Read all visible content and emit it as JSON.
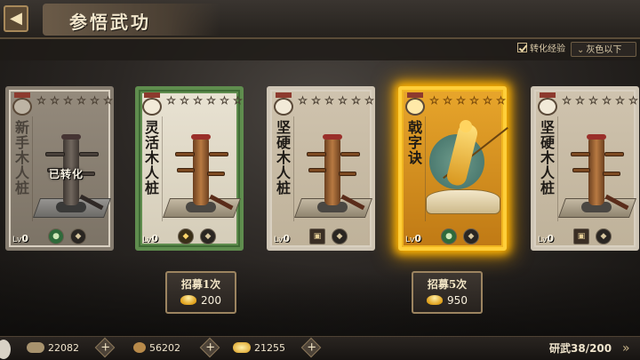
{
  "header": {
    "back_icon": "back-arrow-icon",
    "title": "参悟武功"
  },
  "filters": {
    "convert_exp_label": "转化经验",
    "convert_exp_checked": true,
    "quality_select": "灰色以下"
  },
  "cards": [
    {
      "name": "新手木人桩",
      "stars": 6,
      "state": "dim",
      "overlay": "已转化",
      "level_prefix": "Lv",
      "level": "0",
      "art": "wooden-dummy",
      "icons": [
        "green-circle-icon",
        "gold-ingot-icon"
      ]
    },
    {
      "name": "灵活木人桩",
      "stars": 6,
      "state": "green",
      "level_prefix": "Lv",
      "level": "0",
      "art": "wooden-dummy",
      "icons": [
        "gold-ingot-icon",
        "gold-ingot-icon"
      ]
    },
    {
      "name": "坚硬木人桩",
      "stars": 6,
      "state": "normal",
      "level_prefix": "Lv",
      "level": "0",
      "art": "wooden-dummy",
      "icons": [
        "tile-icon",
        "gold-ingot-icon"
      ]
    },
    {
      "name": "戟字诀",
      "stars": 6,
      "state": "gold",
      "level_prefix": "Lv",
      "level": "0",
      "art": "spear-figure",
      "icons": [
        "green-circle-icon",
        "gold-ingot-icon"
      ]
    },
    {
      "name": "坚硬木人桩",
      "stars": 6,
      "state": "normal",
      "level_prefix": "Lv",
      "level": "0",
      "art": "wooden-dummy",
      "icons": [
        "tile-icon",
        "gold-ingot-icon"
      ]
    }
  ],
  "recruit": [
    {
      "label": "招募1次",
      "cost": "200"
    },
    {
      "label": "招募5次",
      "cost": "950"
    }
  ],
  "resources": [
    {
      "icon": "scroll-icon",
      "value": "22082"
    },
    {
      "icon": "coin-icon",
      "value": "56202"
    },
    {
      "icon": "gold-ingot-icon",
      "value": "21255"
    }
  ],
  "capacity": "研武38/200",
  "colors": {
    "gold_glow": "#ffb400",
    "green_frame": "#5f8d4e",
    "card_frame": "#cfc6b6"
  }
}
